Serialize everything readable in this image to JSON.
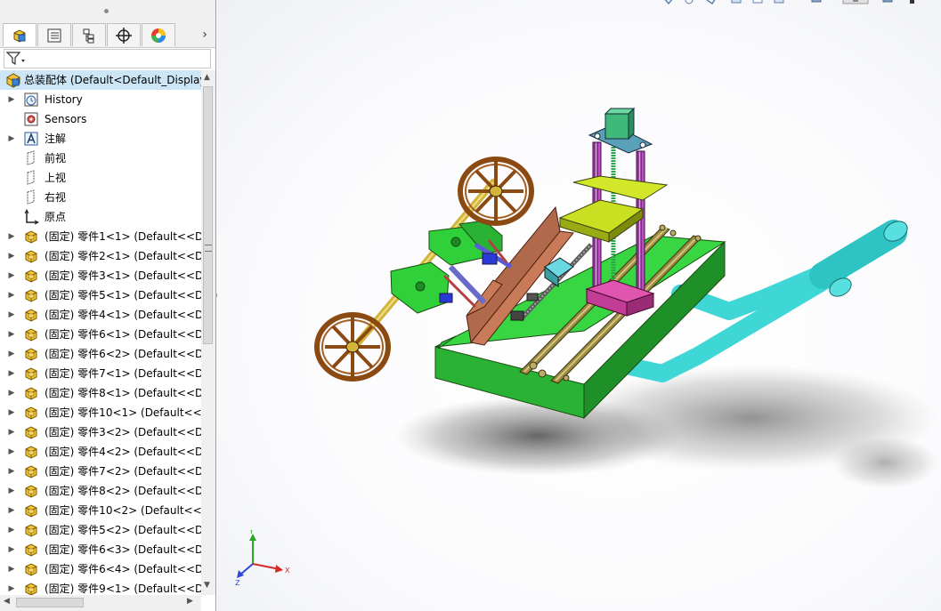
{
  "feature_tree": {
    "tabs": [
      {
        "name": "featuremanager-tab",
        "active": true
      },
      {
        "name": "propertymanager-tab",
        "active": false
      },
      {
        "name": "configurationmanager-tab",
        "active": false
      },
      {
        "name": "dimxpert-tab",
        "active": false
      },
      {
        "name": "display-manager-tab",
        "active": false
      }
    ],
    "more_glyph": "›",
    "root_label": "总装配体  (Default<Default_Display",
    "fixed_items": [
      {
        "label": "History",
        "icon": "history-icon"
      },
      {
        "label": "Sensors",
        "icon": "sensors-icon"
      },
      {
        "label": "注解",
        "icon": "annotations-icon"
      },
      {
        "label": "前视",
        "icon": "plane-icon"
      },
      {
        "label": "上视",
        "icon": "plane-icon"
      },
      {
        "label": "右视",
        "icon": "plane-icon"
      },
      {
        "label": "原点",
        "icon": "origin-icon"
      }
    ],
    "components": [
      "(固定) 零件1<1>  (Default<<De",
      "(固定) 零件2<1>  (Default<<De",
      "(固定) 零件3<1>  (Default<<De",
      "(固定) 零件5<1>  (Default<<De",
      "(固定) 零件4<1>  (Default<<De",
      "(固定) 零件6<1>  (Default<<De",
      "(固定) 零件6<2>  (Default<<De",
      "(固定) 零件7<1>  (Default<<De",
      "(固定) 零件8<1>  (Default<<De",
      "(固定) 零件10<1>  (Default<<D",
      "(固定) 零件3<2>  (Default<<De",
      "(固定) 零件4<2>  (Default<<De",
      "(固定) 零件7<2>  (Default<<De",
      "(固定) 零件8<2>  (Default<<De",
      "(固定) 零件10<2>  (Default<<D",
      "(固定) 零件5<2>  (Default<<De",
      "(固定) 零件6<3>  (Default<<De",
      "(固定) 零件6<4>  (Default<<De",
      "(固定) 零件9<1>  (Default<<De"
    ]
  },
  "triad": {
    "x": "X",
    "y": "Y",
    "z": "Z"
  },
  "colors": {
    "selection": "#cde6f7",
    "base_plate": "#2fd03a",
    "pipe": "#3fd6d6",
    "wheel": "#8b4a12",
    "column": "#c24bc8",
    "platform": "#c8df22",
    "rail": "#8a7a3a"
  }
}
